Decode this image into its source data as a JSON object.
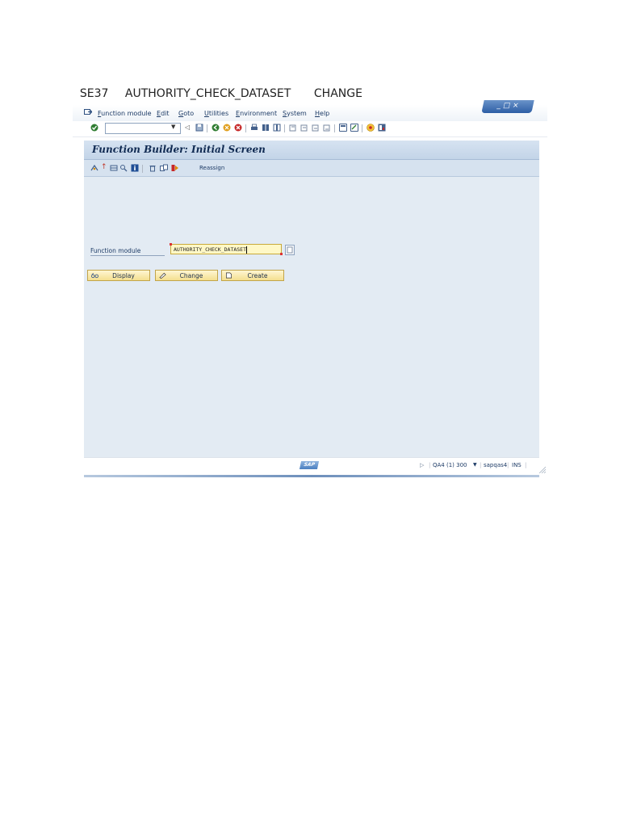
{
  "doc": {
    "tcode": "SE37",
    "object": "AUTHORITY_CHECK_DATASET",
    "action": "CHANGE"
  },
  "window_controls": "_ □ ×",
  "menu": {
    "items": [
      "Function module",
      "Edit",
      "Goto",
      "Utilities",
      "Environment",
      "System",
      "Help"
    ]
  },
  "screen": {
    "title": "Function Builder: Initial Screen",
    "reassign_label": "Reassign",
    "field_label": "Function module",
    "field_value": "AUTHORITY_CHECK_DATASET",
    "buttons": {
      "display": "Display",
      "change": "Change",
      "create": "Create"
    }
  },
  "status": {
    "logo": "SAP",
    "system": "QA4 (1) 300",
    "server": "sapqas4",
    "mode": "INS"
  },
  "colors": {
    "title_text": "#102a52",
    "input_bg": "#fff8c6",
    "button_bg": "#f4df8f",
    "panel_bg": "#e3ebf3"
  }
}
